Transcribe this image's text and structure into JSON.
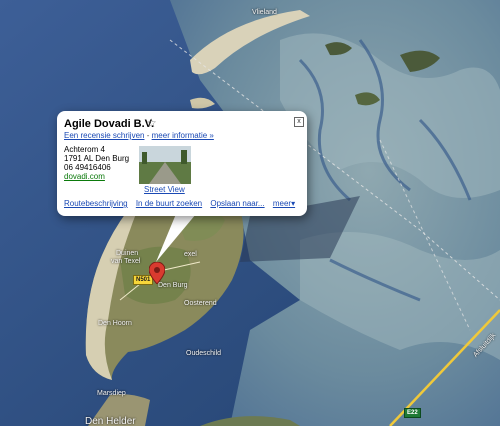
{
  "info_window": {
    "title": "Agile Dovadi B.V.",
    "star_icon": "☆",
    "review_link": "Een recensie schrijven",
    "separator": "-",
    "more_info_link": "meer informatie »",
    "address_line1": "Achterom 4",
    "address_line2": "1791 AL Den Burg",
    "phone": "06 49416406",
    "website": "dovadi.com",
    "street_view_label": "Street View",
    "actions": {
      "directions": "Routebeschrijving",
      "nearby": "In de buurt zoeken",
      "save": "Opslaan naar...",
      "more": "meer▾"
    },
    "close_label": "x"
  },
  "map_labels": {
    "vlieland": "Vlieland",
    "duinen": "Duinen",
    "van_texel": "van Texel",
    "den_burg": "Den Burg",
    "texel": "exel",
    "oosterend": "Oosterend",
    "den_hoorn": "Den Hoorn",
    "oudeschild": "Oudeschild",
    "marsdiep": "Marsdiep",
    "den_helder": "Den Helder",
    "afsluitdijk": "Afsluitdijk",
    "road_n501": "N501",
    "road_e22": "E22"
  },
  "colors": {
    "sea": "#2f4f86",
    "wadden": "#7d9aa8",
    "land": "#8a8a5c",
    "link": "#1a49b4",
    "website": "#0b7a0b",
    "marker": "#d93b2f"
  }
}
